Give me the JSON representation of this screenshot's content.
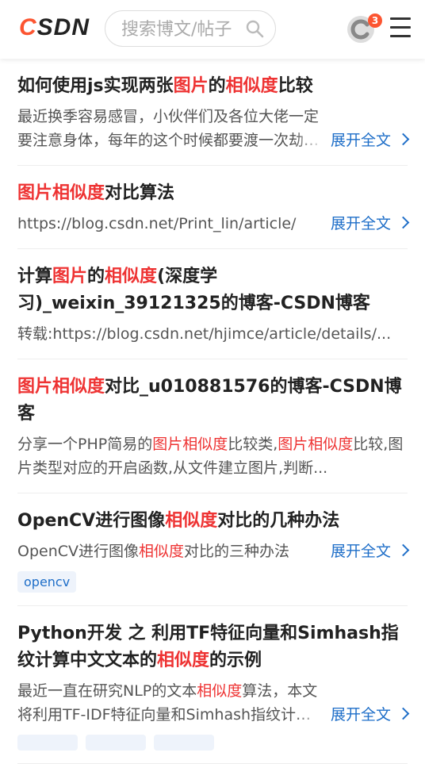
{
  "header": {
    "logo_main": "CSDN",
    "search_placeholder": "搜索博文/帖子",
    "notification_count": "3"
  },
  "items": [
    {
      "title": [
        {
          "t": "如何使用js实现两张"
        },
        {
          "t": "图片",
          "h": true
        },
        {
          "t": "的"
        },
        {
          "t": "相似度",
          "h": true
        },
        {
          "t": "比较"
        }
      ],
      "desc": [
        {
          "t": "最近换季容易感冒，小伙伴们及各位大佬一定要注意身体，每年的这个时候都要渡一次劫。进"
        }
      ],
      "expand": "展开全文"
    },
    {
      "title": [
        {
          "t": "图片相似度",
          "h": true
        },
        {
          "t": "对比算法"
        }
      ],
      "desc": [
        {
          "t": "https://blog.csdn.net/Print_lin/article/"
        }
      ],
      "expand": "展开全文"
    },
    {
      "title": [
        {
          "t": "计算"
        },
        {
          "t": "图片",
          "h": true
        },
        {
          "t": "的"
        },
        {
          "t": "相似度",
          "h": true
        },
        {
          "t": "(深度学习)_weixin_39121325的博客-CSDN博客"
        }
      ],
      "desc": [
        {
          "t": "转载:https://blog.csdn.net/hjimce/article/details/..."
        }
      ]
    },
    {
      "title": [
        {
          "t": "图片相似度",
          "h": true
        },
        {
          "t": "对比_u010881576的博客-CSDN博客"
        }
      ],
      "desc": [
        {
          "t": "分享一个PHP简易的"
        },
        {
          "t": "图片相似度",
          "h": true
        },
        {
          "t": "比较类,"
        },
        {
          "t": "图片相似度",
          "h": true
        },
        {
          "t": "比较,图片类型对应的开启函数,从文件建立图片,判断..."
        }
      ]
    },
    {
      "title": [
        {
          "t": "OpenCV进行图像"
        },
        {
          "t": "相似度",
          "h": true
        },
        {
          "t": "对比的几种办法"
        }
      ],
      "desc": [
        {
          "t": "OpenCV进行图像"
        },
        {
          "t": "相似度",
          "h": true
        },
        {
          "t": "对比的三种办法"
        }
      ],
      "expand": "展开全文",
      "tags": [
        "opencv"
      ]
    },
    {
      "title": [
        {
          "t": "Python开发 之 利用TF特征向量和Simhash指纹计算中文文本的"
        },
        {
          "t": "相似度",
          "h": true
        },
        {
          "t": "的示例"
        }
      ],
      "desc": [
        {
          "t": "最近一直在研究NLP的文本"
        },
        {
          "t": "相似度",
          "h": true
        },
        {
          "t": "算法，本文将利用TF-IDF特征向量和Simhash指纹计算中文"
        }
      ],
      "expand": "展开全文"
    }
  ]
}
